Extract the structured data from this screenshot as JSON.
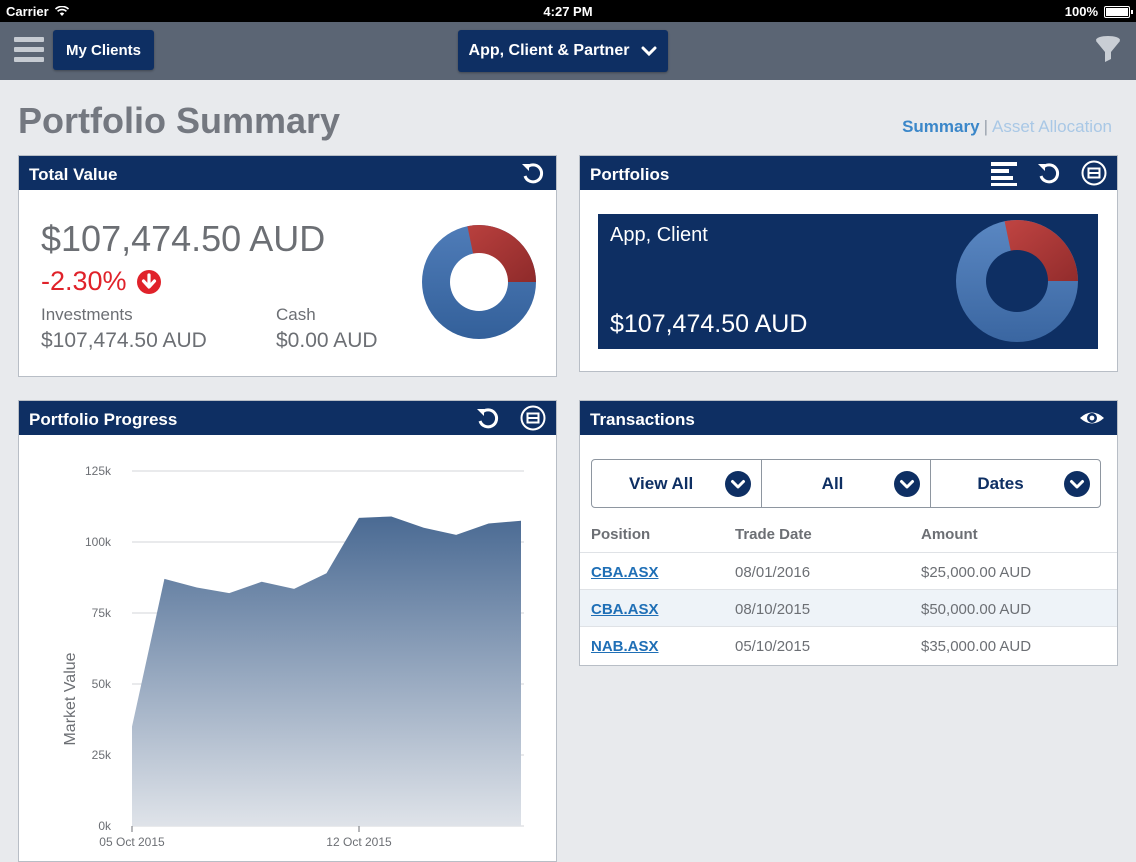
{
  "status_bar": {
    "carrier": "Carrier",
    "time": "4:27 PM",
    "battery": "100%"
  },
  "nav": {
    "my_clients": "My Clients",
    "client_selector": "App, Client & Partner"
  },
  "page": {
    "title": "Portfolio Summary",
    "view_links": {
      "summary": "Summary",
      "separator": "|",
      "asset_allocation": "Asset Allocation"
    }
  },
  "total_value": {
    "title": "Total Value",
    "amount": "$107,474.50 AUD",
    "change": "-2.30%",
    "investments_label": "Investments",
    "investments_value": "$107,474.50 AUD",
    "cash_label": "Cash",
    "cash_value": "$0.00 AUD",
    "donut": {
      "blue_fraction": 0.775,
      "red_fraction": 0.225,
      "blue_color": "#3d6aa5",
      "red_color": "#b23a3a"
    }
  },
  "portfolios": {
    "title": "Portfolios",
    "card_name": "App, Client",
    "card_amount": "$107,474.50 AUD"
  },
  "portfolio_progress": {
    "title": "Portfolio Progress"
  },
  "chart_data": {
    "type": "area",
    "title": "",
    "xlabel": "",
    "ylabel": "Market Value",
    "ylim": [
      0,
      125000
    ],
    "yticks": [
      "0k",
      "25k",
      "50k",
      "75k",
      "100k",
      "125k"
    ],
    "xtick_labels": [
      "05 Oct 2015",
      "12 Oct 2015"
    ],
    "grid": true,
    "series": [
      {
        "values": [
          35000,
          87000,
          84000,
          82000,
          86000,
          83500,
          89000,
          108500,
          109000,
          105000,
          102500,
          106500,
          107500
        ]
      }
    ]
  },
  "transactions": {
    "title": "Transactions",
    "filters": [
      "View All",
      "All",
      "Dates"
    ],
    "columns": [
      "Position",
      "Trade Date",
      "Amount"
    ],
    "rows": [
      {
        "position": "CBA.ASX",
        "date": "08/01/2016",
        "amount": "$25,000.00 AUD"
      },
      {
        "position": "CBA.ASX",
        "date": "08/10/2015",
        "amount": "$50,000.00 AUD"
      },
      {
        "position": "NAB.ASX",
        "date": "05/10/2015",
        "amount": "$35,000.00 AUD"
      }
    ]
  },
  "colors": {
    "navy": "#0e2f63",
    "negative": "#e0222a",
    "link": "#1f6fb6",
    "accent": "#3b87c9"
  },
  "icons": [
    "menu-icon",
    "filter-icon",
    "refresh-icon",
    "minimize-icon",
    "list-icon",
    "eye-icon",
    "chevron-down-icon",
    "down-arrow-icon",
    "wifi-icon",
    "battery-icon"
  ]
}
